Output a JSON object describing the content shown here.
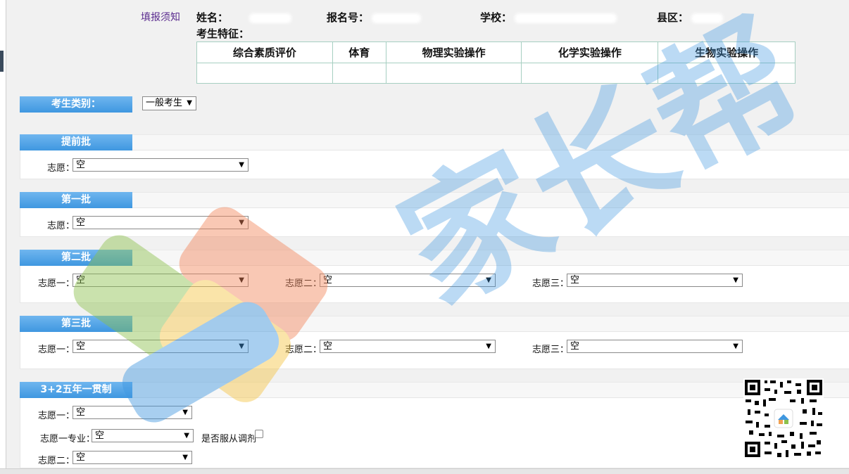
{
  "header": {
    "notice_link": "填报须知",
    "name_label": "姓名：",
    "regno_label": "报名号：",
    "school_label": "学校：",
    "county_label": "县区：",
    "trait_label": "考生特征："
  },
  "traits_table": {
    "columns": [
      "综合素质评价",
      "体育",
      "物理实验操作",
      "化学实验操作",
      "生物实验操作"
    ]
  },
  "candidate_type": {
    "label": "考生类别：",
    "value": "一般考生"
  },
  "sections": {
    "early": {
      "title": "提前批",
      "wish_label": "志愿：",
      "wish_value": "空"
    },
    "batch1": {
      "title": "第一批",
      "wish_label": "志愿：",
      "wish_value": "空"
    },
    "batch2": {
      "title": "第二批",
      "wish1_label": "志愿一：",
      "wish1_value": "空",
      "wish2_label": "志愿二：",
      "wish2_value": "空",
      "wish3_label": "志愿三：",
      "wish3_value": "空"
    },
    "batch3": {
      "title": "第三批",
      "wish1_label": "志愿一：",
      "wish1_value": "空",
      "wish2_label": "志愿二：",
      "wish2_value": "空",
      "wish3_label": "志愿三：",
      "wish3_value": "空"
    },
    "five_year": {
      "title": "3+2五年一贯制",
      "wish1_label": "志愿一：",
      "wish1_value": "空",
      "wish1_major_label": "志愿一专业：",
      "wish1_major_value": "空",
      "accept_adjust_label": "是否服从调剂",
      "wish2_label": "志愿二：",
      "wish2_value": "空"
    }
  },
  "watermark": {
    "text": "家长帮"
  },
  "colors": {
    "section_label": "#3f97e0",
    "link": "#5b2c8f",
    "table_border": "#a6cfc1"
  }
}
